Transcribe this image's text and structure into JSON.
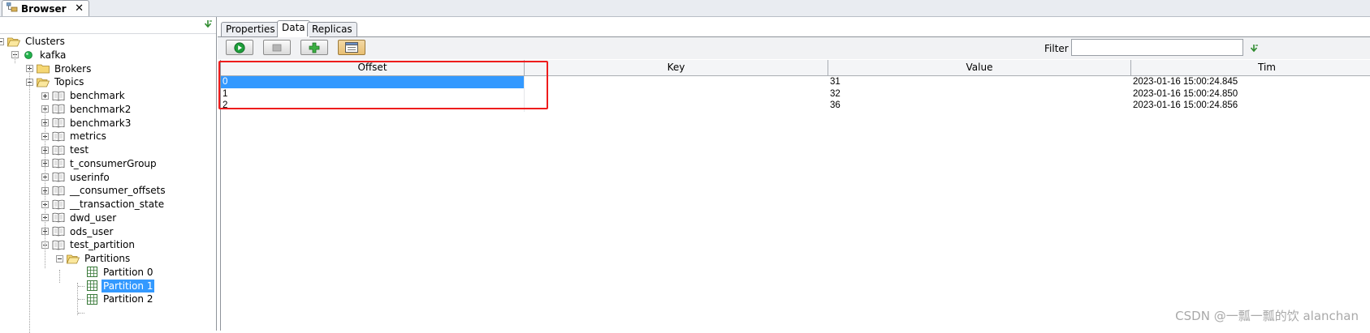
{
  "window": {
    "tab_title": "Browser",
    "tab_close": "✕"
  },
  "tree": {
    "root": "Clusters",
    "cluster": "kafka",
    "brokers": "Brokers",
    "topics_label": "Topics",
    "topics": [
      "benchmark",
      "benchmark2",
      "benchmark3",
      "metrics",
      "test",
      "t_consumerGroup",
      "userinfo",
      "__consumer_offsets",
      "__transaction_state",
      "dwd_user",
      "ods_user",
      "test_partition"
    ],
    "partitions_label": "Partitions",
    "partitions": [
      "Partition 0",
      "Partition 1",
      "Partition 2"
    ],
    "selected": "Partition 1",
    "status_color": "#22b14c"
  },
  "subtabs": [
    "Properties",
    "Data",
    "Replicas"
  ],
  "active_subtab": "Data",
  "toolbar": {
    "filter_label": "Filter",
    "filter_value": "",
    "buttons": [
      "run-icon",
      "stop-icon",
      "add-icon",
      "view-icon"
    ]
  },
  "table": {
    "columns": [
      "Offset",
      "Key",
      "Value",
      "Tim"
    ],
    "rows": [
      {
        "offset": "0",
        "key": "",
        "value": "31",
        "time": "2023-01-16 15:00:24.845"
      },
      {
        "offset": "1",
        "key": "",
        "value": "32",
        "time": "2023-01-16 15:00:24.850"
      },
      {
        "offset": "2",
        "key": "",
        "value": "36",
        "time": "2023-01-16 15:00:24.856"
      }
    ],
    "selected_row": 0
  },
  "colors": {
    "selection": "#3399ff",
    "highlight_box": "#ee1c1c"
  },
  "watermark": "CSDN @一瓢一瓢的饮 alanchan"
}
